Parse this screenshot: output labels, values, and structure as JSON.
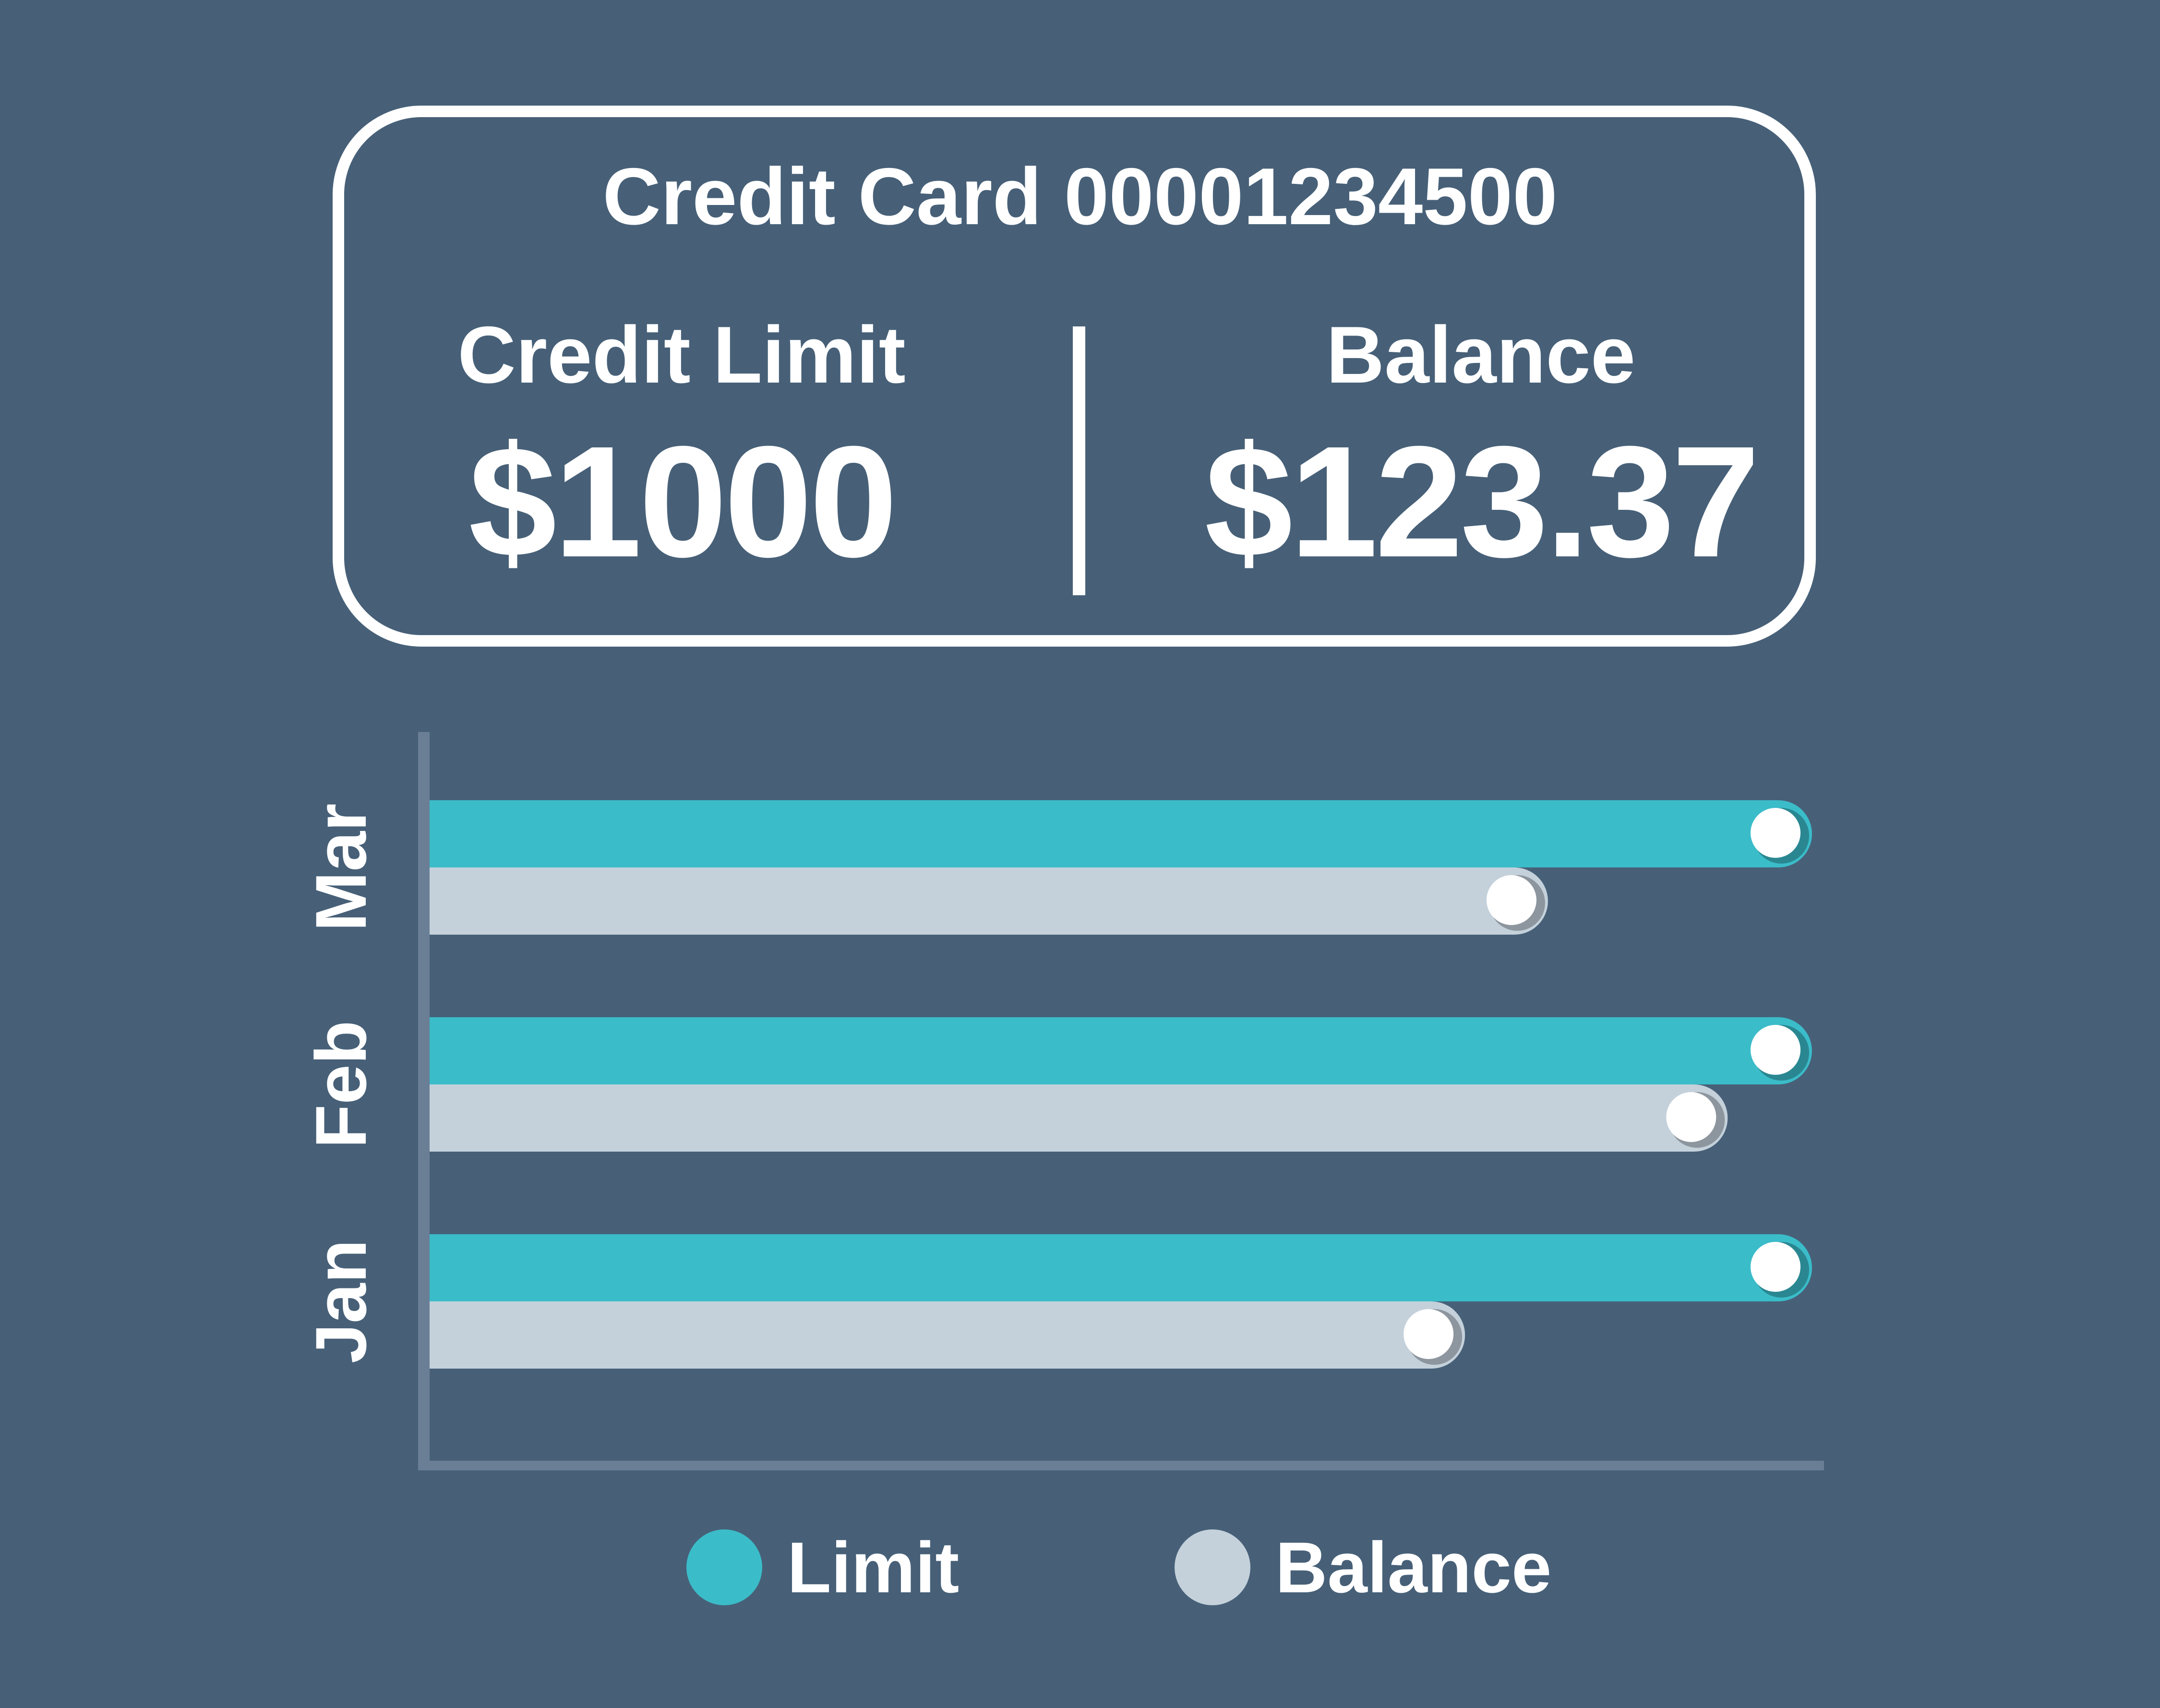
{
  "card": {
    "title": "Credit Card 00001234500",
    "limit_label": "Credit Limit",
    "limit_value": "$1000",
    "balance_label": "Balance",
    "balance_value": "$123.37"
  },
  "colors": {
    "background": "#476078",
    "limit": "#3bbcc9",
    "balance": "#c4d1db",
    "axis": "#6a7f96",
    "text": "#ffffff"
  },
  "chart_data": {
    "type": "bar",
    "orientation": "horizontal",
    "categories": [
      "Mar",
      "Feb",
      "Jan"
    ],
    "series": [
      {
        "name": "Limit",
        "values": [
          1000,
          1000,
          1000
        ]
      },
      {
        "name": "Balance",
        "values": [
          809,
          939,
          749
        ]
      }
    ],
    "xlim": [
      0,
      1000
    ],
    "grid": false,
    "legend": [
      "Limit",
      "Balance"
    ],
    "legend_position": "bottom"
  }
}
